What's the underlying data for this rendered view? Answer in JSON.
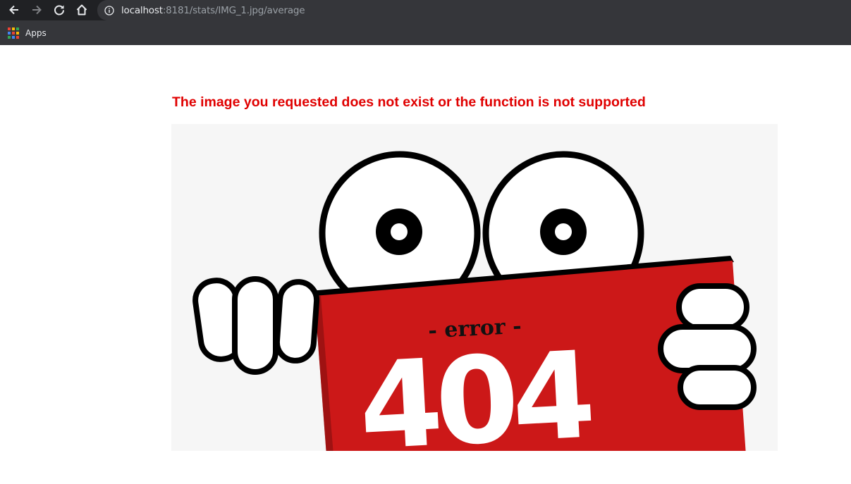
{
  "browser": {
    "url_host": "localhost",
    "url_rest": ":8181/stats/IMG_1.jpg/average",
    "bookmarks": [
      {
        "label": "Apps",
        "icon": "apps-grid-icon"
      }
    ],
    "nav_icons": [
      "back-arrow-icon",
      "forward-arrow-icon",
      "reload-icon",
      "home-icon",
      "info-icon"
    ]
  },
  "page": {
    "error_message": "The image you requested does not exist or the function is not supported",
    "error_color": "#e00000",
    "illustration": {
      "sign_top_text": "- error -",
      "sign_code": "404",
      "sign_color": "#cc1818"
    }
  }
}
